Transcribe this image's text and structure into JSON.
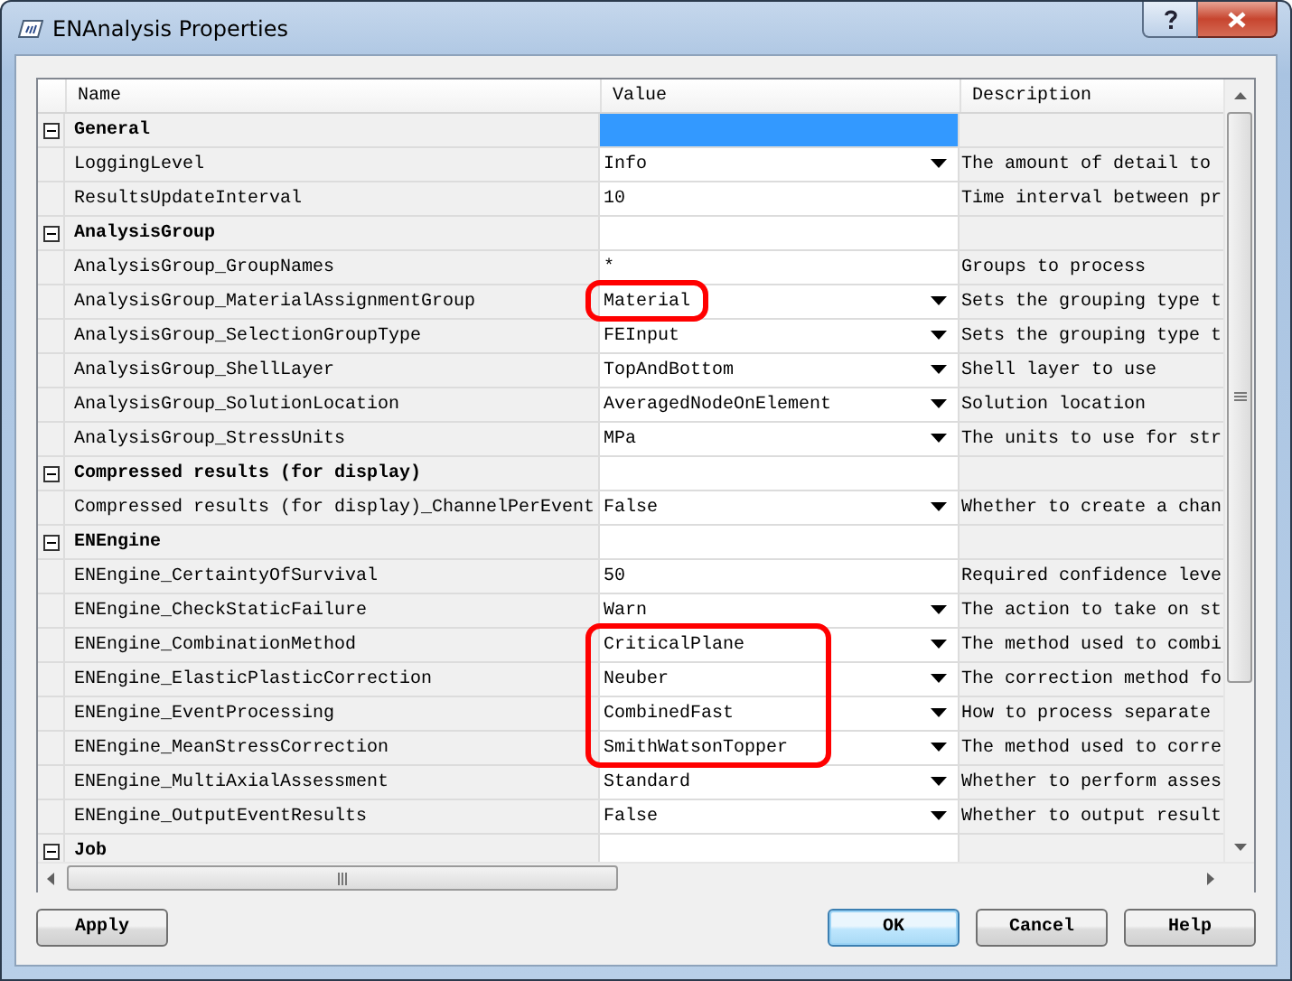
{
  "window": {
    "title": "ENAnalysis Properties"
  },
  "columns": [
    "Name",
    "Value",
    "Description"
  ],
  "groups": [
    {
      "name": "General",
      "expanded": true,
      "selected": true,
      "rows": [
        {
          "name": "LoggingLevel",
          "value": "Info",
          "dropdown": true,
          "description": "The amount of detail to",
          "highlighted": false
        },
        {
          "name": "ResultsUpdateInterval",
          "value": "10",
          "dropdown": false,
          "description": "Time interval between pr",
          "highlighted": false
        }
      ]
    },
    {
      "name": "AnalysisGroup",
      "expanded": true,
      "selected": false,
      "rows": [
        {
          "name": "AnalysisGroup_GroupNames",
          "value": "*",
          "dropdown": false,
          "description": "Groups to process",
          "highlighted": false
        },
        {
          "name": "AnalysisGroup_MaterialAssignmentGroup",
          "value": "Material",
          "dropdown": true,
          "description": "Sets the grouping type t",
          "highlighted": true
        },
        {
          "name": "AnalysisGroup_SelectionGroupType",
          "value": "FEInput",
          "dropdown": true,
          "description": "Sets the grouping type t",
          "highlighted": false
        },
        {
          "name": "AnalysisGroup_ShellLayer",
          "value": "TopAndBottom",
          "dropdown": true,
          "description": "Shell layer to use",
          "highlighted": false
        },
        {
          "name": "AnalysisGroup_SolutionLocation",
          "value": "AveragedNodeOnElement",
          "dropdown": true,
          "description": "Solution location",
          "highlighted": false
        },
        {
          "name": "AnalysisGroup_StressUnits",
          "value": "MPa",
          "dropdown": true,
          "description": "The units to use for str",
          "highlighted": false
        }
      ]
    },
    {
      "name": "Compressed results (for display)",
      "expanded": true,
      "selected": false,
      "rows": [
        {
          "name": "Compressed results (for display)_ChannelPerEvent",
          "value": "False",
          "dropdown": true,
          "description": "Whether to create a chan",
          "highlighted": false
        }
      ]
    },
    {
      "name": "ENEngine",
      "expanded": true,
      "selected": false,
      "rows": [
        {
          "name": "ENEngine_CertaintyOfSurvival",
          "value": "50",
          "dropdown": false,
          "description": "Required confidence leve",
          "highlighted": false
        },
        {
          "name": "ENEngine_CheckStaticFailure",
          "value": "Warn",
          "dropdown": true,
          "description": "The action to take on st",
          "highlighted": false
        },
        {
          "name": "ENEngine_CombinationMethod",
          "value": "CriticalPlane",
          "dropdown": true,
          "description": "The method used to combi",
          "highlighted": true
        },
        {
          "name": "ENEngine_ElasticPlasticCorrection",
          "value": "Neuber",
          "dropdown": true,
          "description": "The correction method fo",
          "highlighted": true
        },
        {
          "name": "ENEngine_EventProcessing",
          "value": "CombinedFast",
          "dropdown": true,
          "description": "How to process separate",
          "highlighted": true
        },
        {
          "name": "ENEngine_MeanStressCorrection",
          "value": "SmithWatsonTopper",
          "dropdown": true,
          "description": "The method used to corre",
          "highlighted": true
        },
        {
          "name": "ENEngine_MultiAxialAssessment",
          "value": "Standard",
          "dropdown": true,
          "description": "Whether to perform asses",
          "highlighted": false
        },
        {
          "name": "ENEngine_OutputEventResults",
          "value": "False",
          "dropdown": true,
          "description": "Whether to output result",
          "highlighted": false
        }
      ]
    },
    {
      "name": "Job",
      "expanded": true,
      "selected": false
    }
  ],
  "buttons_left": [
    {
      "label": "Apply",
      "default": false
    }
  ],
  "buttons_right": [
    {
      "label": "OK",
      "default": true
    },
    {
      "label": "Cancel",
      "default": false
    },
    {
      "label": "Help",
      "default": false
    }
  ]
}
